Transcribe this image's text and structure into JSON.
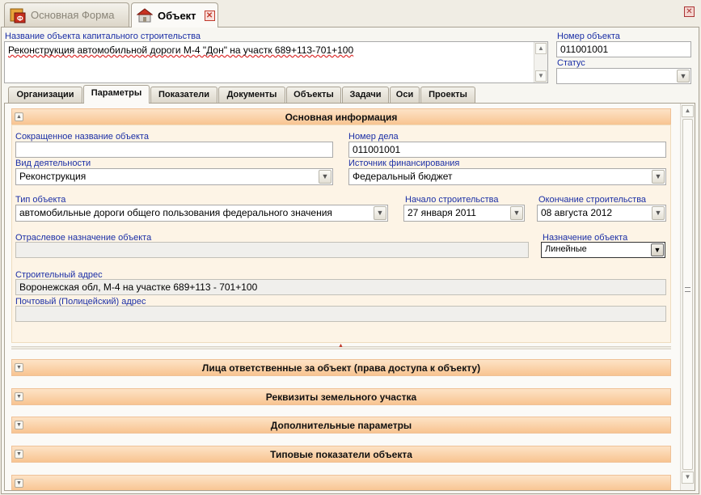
{
  "tabs": [
    {
      "label": "Основная Форма",
      "icon": "form-app-icon",
      "active": false
    },
    {
      "label": "Объект",
      "icon": "house-icon",
      "active": true
    }
  ],
  "header": {
    "name_label": "Название объекта капитального строительства",
    "name_value": "Реконструкция автомобильной дороги М-4 \"Дон\" на участк 689+113-701+100",
    "number_label": "Номер объекта",
    "number_value": "011001001",
    "status_label": "Статус",
    "status_value": ""
  },
  "page_tabs": [
    "Организации",
    "Параметры",
    "Показатели",
    "Документы",
    "Объекты",
    "Задачи",
    "Оси",
    "Проекты"
  ],
  "active_page_tab": "Параметры",
  "main_section": {
    "title": "Основная информация",
    "short_name_label": "Сокращенное название объекта",
    "short_name_value": "",
    "case_number_label": "Номер дела",
    "case_number_value": "011001001",
    "activity_label": "Вид деятельности",
    "activity_value": "Реконструкция",
    "funding_label": "Источник финансирования",
    "funding_value": "Федеральный бюджет",
    "object_type_label": "Тип объекта",
    "object_type_value": "автомобильные дороги общего пользования федерального значения",
    "start_label": "Начало строительства",
    "start_value": "27 января 2011",
    "end_label": "Окончание строительства",
    "end_value": "08 августа 2012",
    "industry_label": "Отраслевое назначение объекта",
    "industry_value": "",
    "purpose_label": "Назначение объекта",
    "purpose_value": "Линейные",
    "address_label": "Строительный адрес",
    "address_value": "Воронежская обл, М-4 на участке 689+113 - 701+100",
    "postal_label": "Почтовый (Полицейский) адрес",
    "postal_value": ""
  },
  "collapsed_sections": [
    "Лица ответственные за объект (права доступа к объекту)",
    "Реквизиты земельного участка",
    "Дополнительные параметры",
    "Типовые показатели объекта"
  ],
  "colors": {
    "section_header": "#f8c491",
    "label_blue": "#1b2fa6",
    "close_red": "#c0392b"
  }
}
